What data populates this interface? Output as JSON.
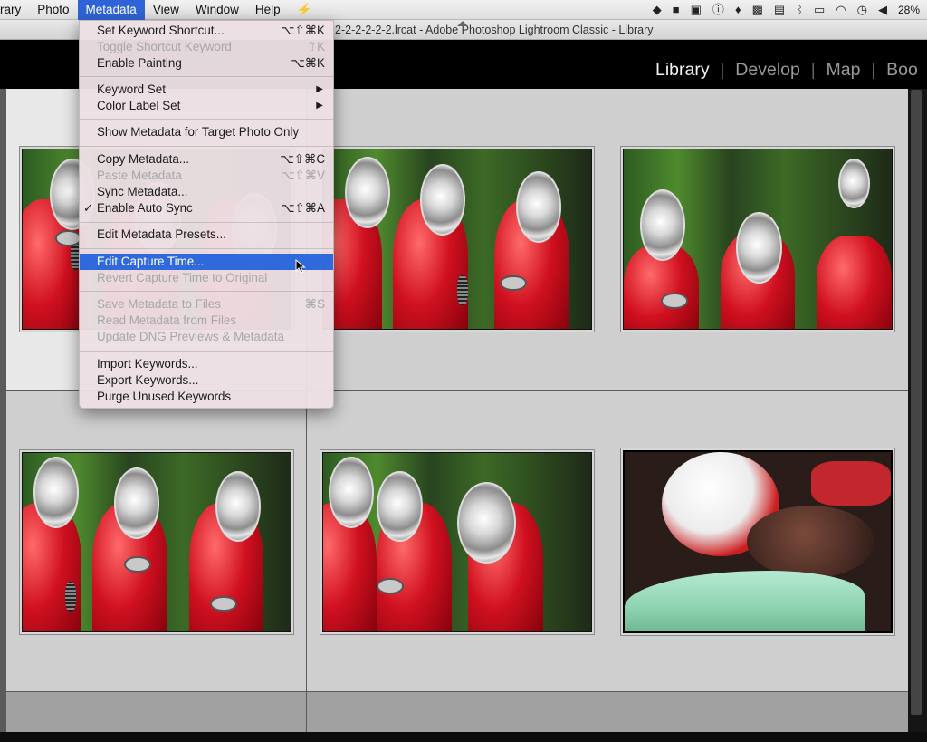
{
  "menubar": {
    "items": [
      "rary",
      "Photo",
      "Metadata",
      "View",
      "Window",
      "Help"
    ],
    "active": "Metadata",
    "status_icons": [
      "dropbox-icon",
      "facetime-icon",
      "window-icon",
      "onepassword-icon",
      "flame-icon",
      "stocks-icon",
      "screen-icon",
      "bluetooth-icon",
      "airplay-icon",
      "wifi-icon",
      "time-machine-icon",
      "volume-icon"
    ],
    "battery": "28%"
  },
  "window": {
    "title": "2-2-2-2-2-2.lrcat - Adobe Photoshop Lightroom Classic - Library"
  },
  "modules": {
    "items": [
      "Library",
      "Develop",
      "Map",
      "Boo"
    ],
    "active": "Library"
  },
  "menu": {
    "items": [
      {
        "label": "Set Keyword Shortcut...",
        "shortcut": "⌥⇧⌘K",
        "enabled": true
      },
      {
        "label": "Toggle Shortcut Keyword",
        "shortcut": "⇧K",
        "enabled": false
      },
      {
        "label": "Enable Painting",
        "shortcut": "⌥⌘K",
        "enabled": true
      },
      {
        "label": "Keyword Set",
        "shortcut": "▶",
        "enabled": true
      },
      {
        "label": "Color Label Set",
        "shortcut": "▶",
        "enabled": true
      },
      {
        "label": "Show Metadata for Target Photo Only",
        "shortcut": "",
        "enabled": true
      },
      {
        "label": "Copy Metadata...",
        "shortcut": "⌥⇧⌘C",
        "enabled": true
      },
      {
        "label": "Paste Metadata",
        "shortcut": "⌥⇧⌘V",
        "enabled": false
      },
      {
        "label": "Sync Metadata...",
        "shortcut": "",
        "enabled": true
      },
      {
        "label": "Enable Auto Sync",
        "shortcut": "⌥⇧⌘A",
        "enabled": true,
        "checked": true
      },
      {
        "label": "Edit Metadata Presets...",
        "shortcut": "",
        "enabled": true
      },
      {
        "label": "Edit Capture Time...",
        "shortcut": "",
        "enabled": true,
        "highlighted": true
      },
      {
        "label": "Revert Capture Time to Original",
        "shortcut": "",
        "enabled": false
      },
      {
        "label": "Save Metadata to Files",
        "shortcut": "⌘S",
        "enabled": false
      },
      {
        "label": "Read Metadata from Files",
        "shortcut": "",
        "enabled": false
      },
      {
        "label": "Update DNG Previews & Metadata",
        "shortcut": "",
        "enabled": false
      },
      {
        "label": "Import Keywords...",
        "shortcut": "",
        "enabled": true
      },
      {
        "label": "Export Keywords...",
        "shortcut": "",
        "enabled": true
      },
      {
        "label": "Purge Unused Keywords",
        "shortcut": "",
        "enabled": true
      }
    ]
  },
  "grid": {
    "cells": [
      {
        "photo": "red-scooters",
        "selected": true
      },
      {
        "photo": "red-scooters",
        "selected": false
      },
      {
        "photo": "red-scooters",
        "selected": false
      },
      {
        "photo": "red-scooters",
        "selected": false
      },
      {
        "photo": "red-scooters",
        "selected": false
      },
      {
        "photo": "helmets-mint-scooter",
        "selected": false
      }
    ]
  }
}
